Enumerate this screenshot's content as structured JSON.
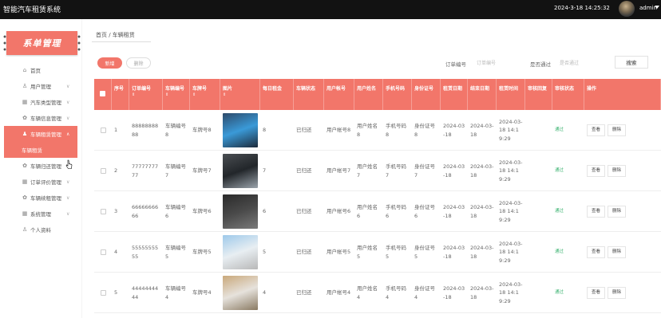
{
  "app": {
    "title": "智能汽车租赁系统",
    "datetime": "2024-3-18 14:25:32",
    "user": "admin"
  },
  "sidebar": {
    "menu_title": "系单管理",
    "items": [
      {
        "icon": "home-icon",
        "glyph": "⌂",
        "label": "首页"
      },
      {
        "icon": "user-icon",
        "glyph": "♙",
        "label": "用户管理"
      },
      {
        "icon": "grid-icon",
        "glyph": "▦",
        "label": "汽车类型管理"
      },
      {
        "icon": "gear-icon",
        "glyph": "✿",
        "label": "车辆信息管理"
      },
      {
        "icon": "person-icon",
        "glyph": "♟",
        "label": "车辆租赁管理"
      },
      {
        "icon": "gear-icon",
        "glyph": "✿",
        "label": "车辆归还管理"
      },
      {
        "icon": "grid-icon",
        "glyph": "▦",
        "label": "订单评价管理"
      },
      {
        "icon": "gear-icon",
        "glyph": "✿",
        "label": "车辆续租管理"
      },
      {
        "icon": "grid-icon",
        "glyph": "▦",
        "label": "系统管理"
      },
      {
        "icon": "user-icon",
        "glyph": "♙",
        "label": "个人资料"
      }
    ],
    "active_sub": "车辆租赁"
  },
  "breadcrumb": "首页 / 车辆租赁",
  "toolbar": {
    "add_label": "新增",
    "delete_label": "删除",
    "filter1_label": "订单编号",
    "filter1_placeholder": "订单编号",
    "filter2_label": "是否通过",
    "filter2_placeholder": "是否通过",
    "search_label": "搜索"
  },
  "columns": [
    "序号",
    "订单编号",
    "车辆编号",
    "车牌号",
    "图片",
    "每日租金",
    "车辆状态",
    "用户帐号",
    "用户姓名",
    "手机号码",
    "身份证号",
    "租赁日期",
    "结束日期",
    "租赁时间",
    "审核回复",
    "审核状态",
    "操作"
  ],
  "rows": [
    {
      "index": "1",
      "order": "8888888888",
      "vehicle": "车辆编号8",
      "plate": "车牌号8",
      "rent": "8",
      "status": "已归还",
      "account": "用户帐号8",
      "name": "用户姓名8",
      "phone": "手机号码8",
      "idcard": "身份证号8",
      "start": "2024-03-18",
      "end": "2024-03-18",
      "time": "2024-03-18 14:19:29",
      "reply": "",
      "audit": "通过",
      "c1": "#2d4a6a",
      "c2": "#3a9ad8",
      "c3": "#1d2a3a"
    },
    {
      "index": "2",
      "order": "7777777777",
      "vehicle": "车辆编号7",
      "plate": "车牌号7",
      "rent": "7",
      "status": "已归还",
      "account": "用户帐号7",
      "name": "用户姓名7",
      "phone": "手机号码7",
      "idcard": "身份证号7",
      "start": "2024-03-18",
      "end": "2024-03-18",
      "time": "2024-03-18 14:19:29",
      "reply": "",
      "audit": "通过",
      "c1": "#4a4e52",
      "c2": "#22262a",
      "c3": "#9aa3ab"
    },
    {
      "index": "3",
      "order": "6666666666",
      "vehicle": "车辆编号6",
      "plate": "车牌号6",
      "rent": "6",
      "status": "已归还",
      "account": "用户帐号6",
      "name": "用户姓名6",
      "phone": "手机号码6",
      "idcard": "身份证号6",
      "start": "2024-03-18",
      "end": "2024-03-18",
      "time": "2024-03-18 14:19:29",
      "reply": "",
      "audit": "通过",
      "c1": "#2a2a2a",
      "c2": "#4a4a4a",
      "c3": "#7a7a7a"
    },
    {
      "index": "4",
      "order": "5555555555",
      "vehicle": "车辆编号5",
      "plate": "车牌号5",
      "rent": "5",
      "status": "已归还",
      "account": "用户帐号5",
      "name": "用户姓名5",
      "phone": "手机号码5",
      "idcard": "身份证号5",
      "start": "2024-03-18",
      "end": "2024-03-18",
      "time": "2024-03-18 14:19:29",
      "reply": "",
      "audit": "通过",
      "c1": "#9ec9ea",
      "c2": "#e8eef2",
      "c3": "#b8b8b8"
    },
    {
      "index": "5",
      "order": "4444444444",
      "vehicle": "车辆编号4",
      "plate": "车牌号4",
      "rent": "4",
      "status": "已归还",
      "account": "用户帐号4",
      "name": "用户姓名4",
      "phone": "手机号码4",
      "idcard": "身份证号4",
      "start": "2024-03-18",
      "end": "2024-03-18",
      "time": "2024-03-18 14:19:29",
      "reply": "",
      "audit": "通过",
      "c1": "#c9a87a",
      "c2": "#e6e2dc",
      "c3": "#8a7a62"
    }
  ],
  "actions": {
    "view_label": "查看",
    "delete_label": "删除"
  }
}
